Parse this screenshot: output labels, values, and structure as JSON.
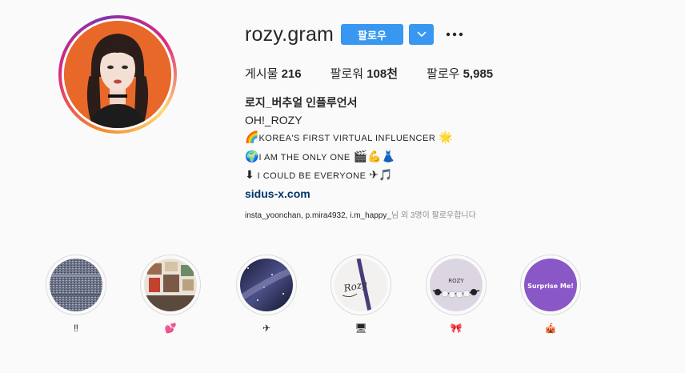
{
  "profile": {
    "username": "rozy.gram",
    "follow_label": "팔로우",
    "stats": {
      "posts_label": "게시물",
      "posts_count": "216",
      "followers_label": "팔로워",
      "followers_count": "108천",
      "following_label": "팔로우",
      "following_count": "5,985"
    },
    "bio": {
      "name": "로지_버추얼 인플루언서",
      "line1": "OH!_ROZY",
      "line2_emoji_start": "🌈",
      "line2_text": "KOREA'S FIRST VIRTUAL INFLUENCER",
      "line2_emoji_end": "🌟",
      "line3_emoji_start": "🌍",
      "line3_text": "I AM THE ONLY ONE",
      "line3_emoji_end": "🎬💪👗",
      "line4_emoji_start": "⬇",
      "line4_text": "I COULD BE EVERYONE",
      "line4_emoji_end": "✈🎵",
      "link": "sidus-x.com"
    },
    "followed_by": {
      "names": "insta_yoonchan, p.mira4932, i.m_happy_",
      "suffix": "님 외 3명이 팔로우합니다"
    }
  },
  "highlights": [
    {
      "label": "‼",
      "icon": "static-noise"
    },
    {
      "label": "💕",
      "icon": "room-photos"
    },
    {
      "label": "✈",
      "icon": "galaxy"
    },
    {
      "label": "🖥",
      "icon": "rozy-sketch"
    },
    {
      "label": "🎀",
      "icon": "rozy-beads"
    },
    {
      "label": "🎪",
      "icon": "surprise-me"
    }
  ],
  "highlight_texts": {
    "beads": "ROZY",
    "surprise": "Surprise Me!",
    "sketch": "Rozy"
  },
  "colors": {
    "accent": "#3897f0",
    "link": "#003569",
    "avatar_bg": "#e8682a"
  }
}
